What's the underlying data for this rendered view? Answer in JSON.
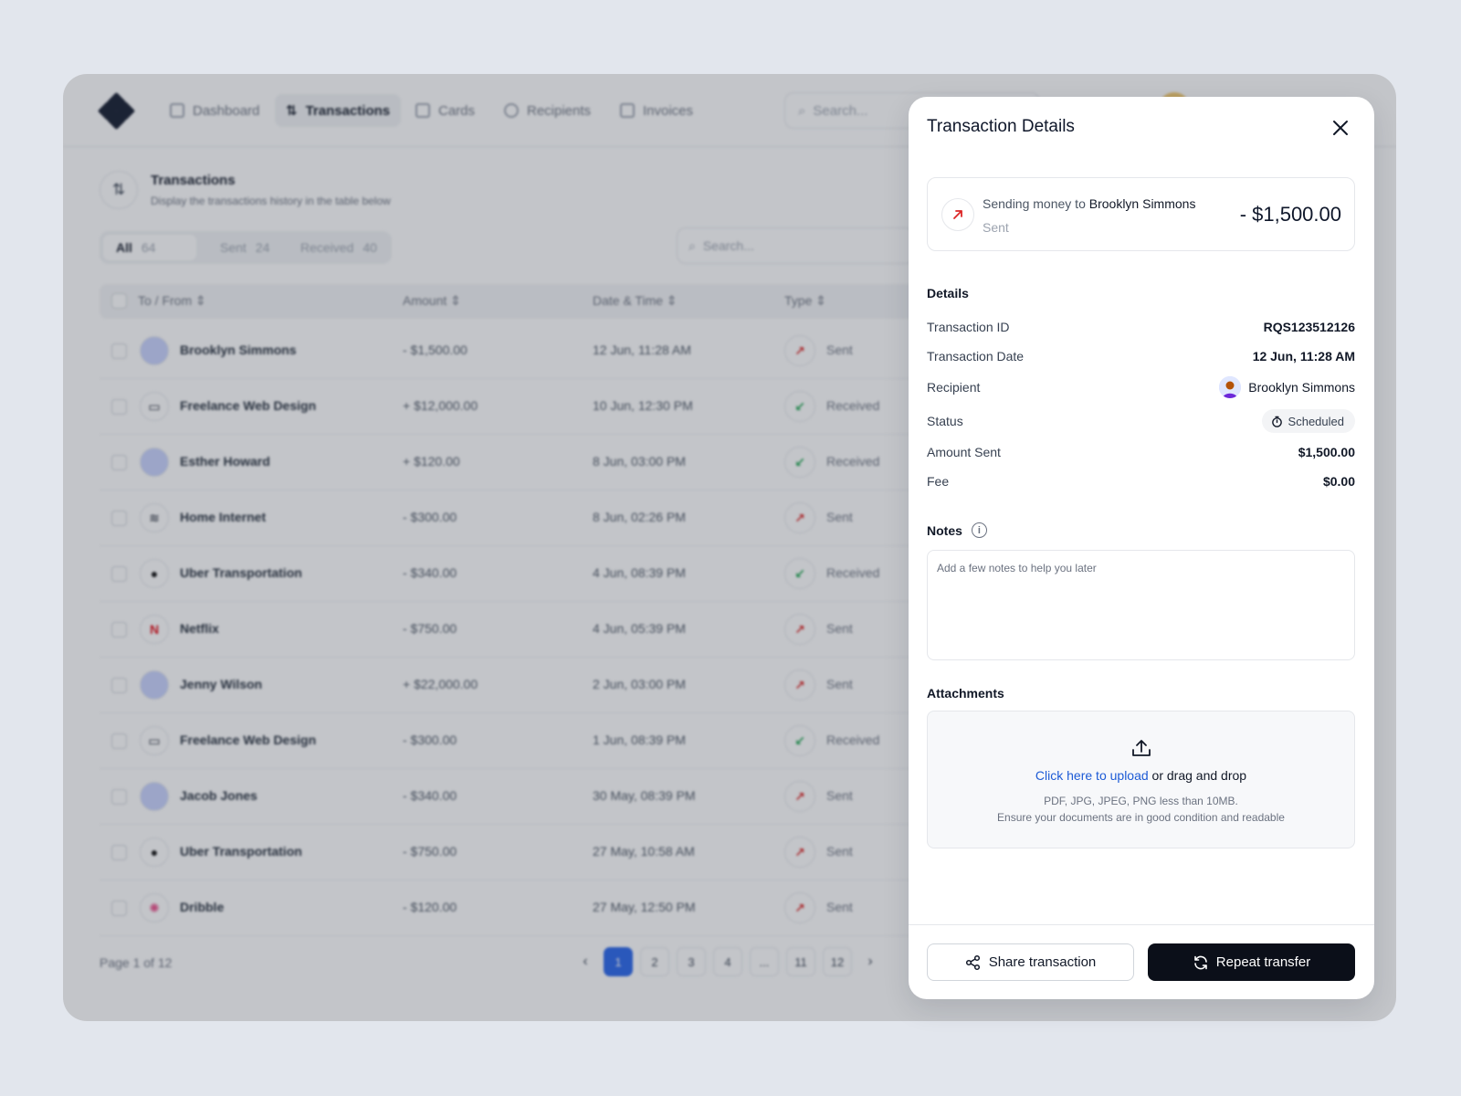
{
  "nav": {
    "items": [
      {
        "label": "Dashboard",
        "icon": "grid-icon"
      },
      {
        "label": "Transactions",
        "icon": "arrows-up-down-icon"
      },
      {
        "label": "Cards",
        "icon": "card-icon"
      },
      {
        "label": "Recipients",
        "icon": "users-icon"
      },
      {
        "label": "Invoices",
        "icon": "invoice-icon"
      }
    ],
    "search_placeholder": "Search..."
  },
  "page": {
    "title": "Transactions",
    "subtitle": "Display the transactions history in the table below"
  },
  "filters": [
    {
      "label": "All",
      "count": "64"
    },
    {
      "label": "Sent",
      "count": "24"
    },
    {
      "label": "Received",
      "count": "40"
    }
  ],
  "table_search_placeholder": "Search...",
  "table": {
    "columns": [
      "To / From",
      "Amount",
      "Date & Time",
      "Type"
    ],
    "rows": [
      {
        "name": "Brooklyn Simmons",
        "amount": "- $1,500.00",
        "date": "12 Jun, 11:28 AM",
        "type": "Sent",
        "avatar": "person-avatar"
      },
      {
        "name": "Freelance Web Design",
        "amount": "+ $12,000.00",
        "date": "10 Jun, 12:30 PM",
        "type": "Received",
        "avatar": "monitor-icon"
      },
      {
        "name": "Esther Howard",
        "amount": "+ $120.00",
        "date": "8 Jun, 03:00 PM",
        "type": "Received",
        "avatar": "person-avatar"
      },
      {
        "name": "Home Internet",
        "amount": "- $300.00",
        "date": "8 Jun, 02:26 PM",
        "type": "Sent",
        "avatar": "wifi-icon"
      },
      {
        "name": "Uber Transportation",
        "amount": "- $340.00",
        "date": "4 Jun, 08:39 PM",
        "type": "Received",
        "avatar": "uber-logo"
      },
      {
        "name": "Netflix",
        "amount": "- $750.00",
        "date": "4 Jun, 05:39 PM",
        "type": "Sent",
        "avatar": "netflix-logo"
      },
      {
        "name": "Jenny Wilson",
        "amount": "+ $22,000.00",
        "date": "2 Jun, 03:00 PM",
        "type": "Sent",
        "avatar": "person-avatar"
      },
      {
        "name": "Freelance Web Design",
        "amount": "- $300.00",
        "date": "1 Jun, 08:39 PM",
        "type": "Received",
        "avatar": "monitor-icon"
      },
      {
        "name": "Jacob Jones",
        "amount": "- $340.00",
        "date": "30 May, 08:39 PM",
        "type": "Sent",
        "avatar": "person-avatar"
      },
      {
        "name": "Uber Transportation",
        "amount": "- $750.00",
        "date": "27 May, 10:58 AM",
        "type": "Sent",
        "avatar": "uber-logo"
      },
      {
        "name": "Dribble",
        "amount": "- $120.00",
        "date": "27 May, 12:50 PM",
        "type": "Sent",
        "avatar": "dribbble-logo"
      }
    ]
  },
  "pagination": {
    "info": "Page 1 of 12",
    "pages": [
      "1",
      "2",
      "3",
      "4",
      "...",
      "11",
      "12"
    ],
    "current": "1"
  },
  "panel": {
    "title": "Transaction Details",
    "summary": {
      "prefix": "Sending money to",
      "recipient": "Brooklyn Simmons",
      "status": "Sent",
      "amount": "- $1,500.00"
    },
    "details_title": "Details",
    "details": {
      "transaction_id": {
        "label": "Transaction ID",
        "value": "RQS123512126"
      },
      "transaction_date": {
        "label": "Transaction Date",
        "value": "12 Jun, 11:28 AM"
      },
      "recipient": {
        "label": "Recipient",
        "value": "Brooklyn Simmons"
      },
      "status": {
        "label": "Status",
        "value": "Scheduled"
      },
      "amount_sent": {
        "label": "Amount Sent",
        "value": "$1,500.00"
      },
      "fee": {
        "label": "Fee",
        "value": "$0.00"
      }
    },
    "notes_label": "Notes",
    "notes_placeholder": "Add a few notes to help you later",
    "attachments_label": "Attachments",
    "upload": {
      "link": "Click here to upload",
      "rest": " or drag and drop",
      "hint1": "PDF, JPG, JPEG, PNG less than 10MB.",
      "hint2": "Ensure your documents are in good condition and readable"
    },
    "share_label": "Share transaction",
    "repeat_label": "Repeat transfer"
  },
  "colors": {
    "sent": "#dc2626",
    "received": "#16a34a",
    "link": "#1d5bd6",
    "primary_button": "#0b0f19",
    "page_active": "#2563eb"
  }
}
